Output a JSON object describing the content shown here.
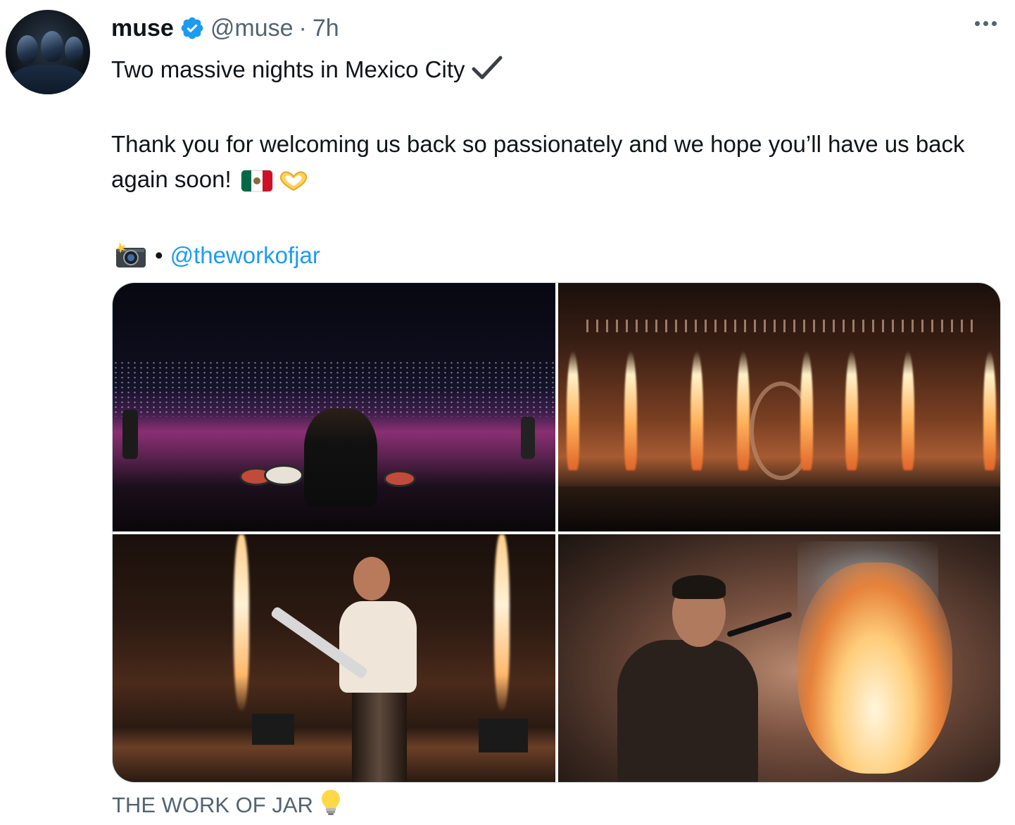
{
  "author": {
    "name": "muse",
    "handle": "@muse",
    "separator": "·",
    "time": "7h",
    "verified": true,
    "avatar_icon": "band-avatar"
  },
  "tweet": {
    "line1": "Two massive nights in Mexico City",
    "line1_emoji": "check-mark-icon",
    "line2": "Thank you for welcoming us back so passionately and we hope you’ll have us back again soon!",
    "line2_emojis": [
      "mexico-flag-icon",
      "heart-hands-icon"
    ],
    "credit_icon": "camera-flash-icon",
    "credit_bullet": "•",
    "credit_mention": "@theworkofjar"
  },
  "media": {
    "photos": [
      {
        "description": "drummer-stadium"
      },
      {
        "description": "stage-pyro"
      },
      {
        "description": "guitarist-pyro"
      },
      {
        "description": "bassist-fire"
      }
    ]
  },
  "caption": {
    "text": "THE WORK OF JAR",
    "icon": "light-bulb-icon"
  },
  "colors": {
    "link": "#1d9bf0",
    "verified": "#1d9bf0",
    "muted": "#536471",
    "text": "#0f1419",
    "border": "#cfd9de"
  }
}
